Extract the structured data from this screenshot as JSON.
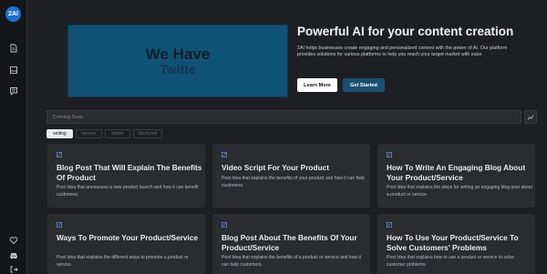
{
  "sidebar": {
    "logo_text": "2AI",
    "icons": [
      "document-icon",
      "layout-icon",
      "chat-icon",
      "heart-icon",
      "discord-icon",
      "logout-icon"
    ]
  },
  "hero": {
    "image_line1": "We Have",
    "image_line2": "Twitte",
    "title": "Powerful AI for your content creation",
    "description": "2AI helps businesses create engaging and personalized content with the power of AI. Our platform provides solutions for various platforms to help you reach your target market with ease.",
    "learn_more": "Learn More",
    "get_started": "Get Started"
  },
  "search": {
    "placeholder": "Coming Soon"
  },
  "tabs": [
    "writing",
    "tweeter",
    "twitter",
    "facebook"
  ],
  "cards": [
    {
      "title": "Blog Post That Will Explain The Benefits Of Product",
      "desc": "Post Idea that announces a new product launch and how it can benefit customers."
    },
    {
      "title": "Video Script For Your Product",
      "desc": "Post Idea that explains the benefits of your product and how it can help customers."
    },
    {
      "title": "How To Write An Engaging Blog About Your Product/Service",
      "desc": "Post Idea that explains the steps for writing an engaging blog post about a product or service."
    },
    {
      "title": "Ways To Promote Your Product/Service",
      "desc": "Post Idea that explains the different ways to promote a product or service."
    },
    {
      "title": "Blog Post About The Benefits Of Your Product/Service",
      "desc": "Post Idea that explains the benefits of a product or service and how it can help customers."
    },
    {
      "title": "How To Use Your Product/Service To Solve Customers' Problems",
      "desc": "Post Idea that explains how to use a product or service to solve customer problems."
    }
  ],
  "colors": {
    "accent": "#1a4f73",
    "background": "#1e1f22",
    "card": "#2b2c30"
  }
}
